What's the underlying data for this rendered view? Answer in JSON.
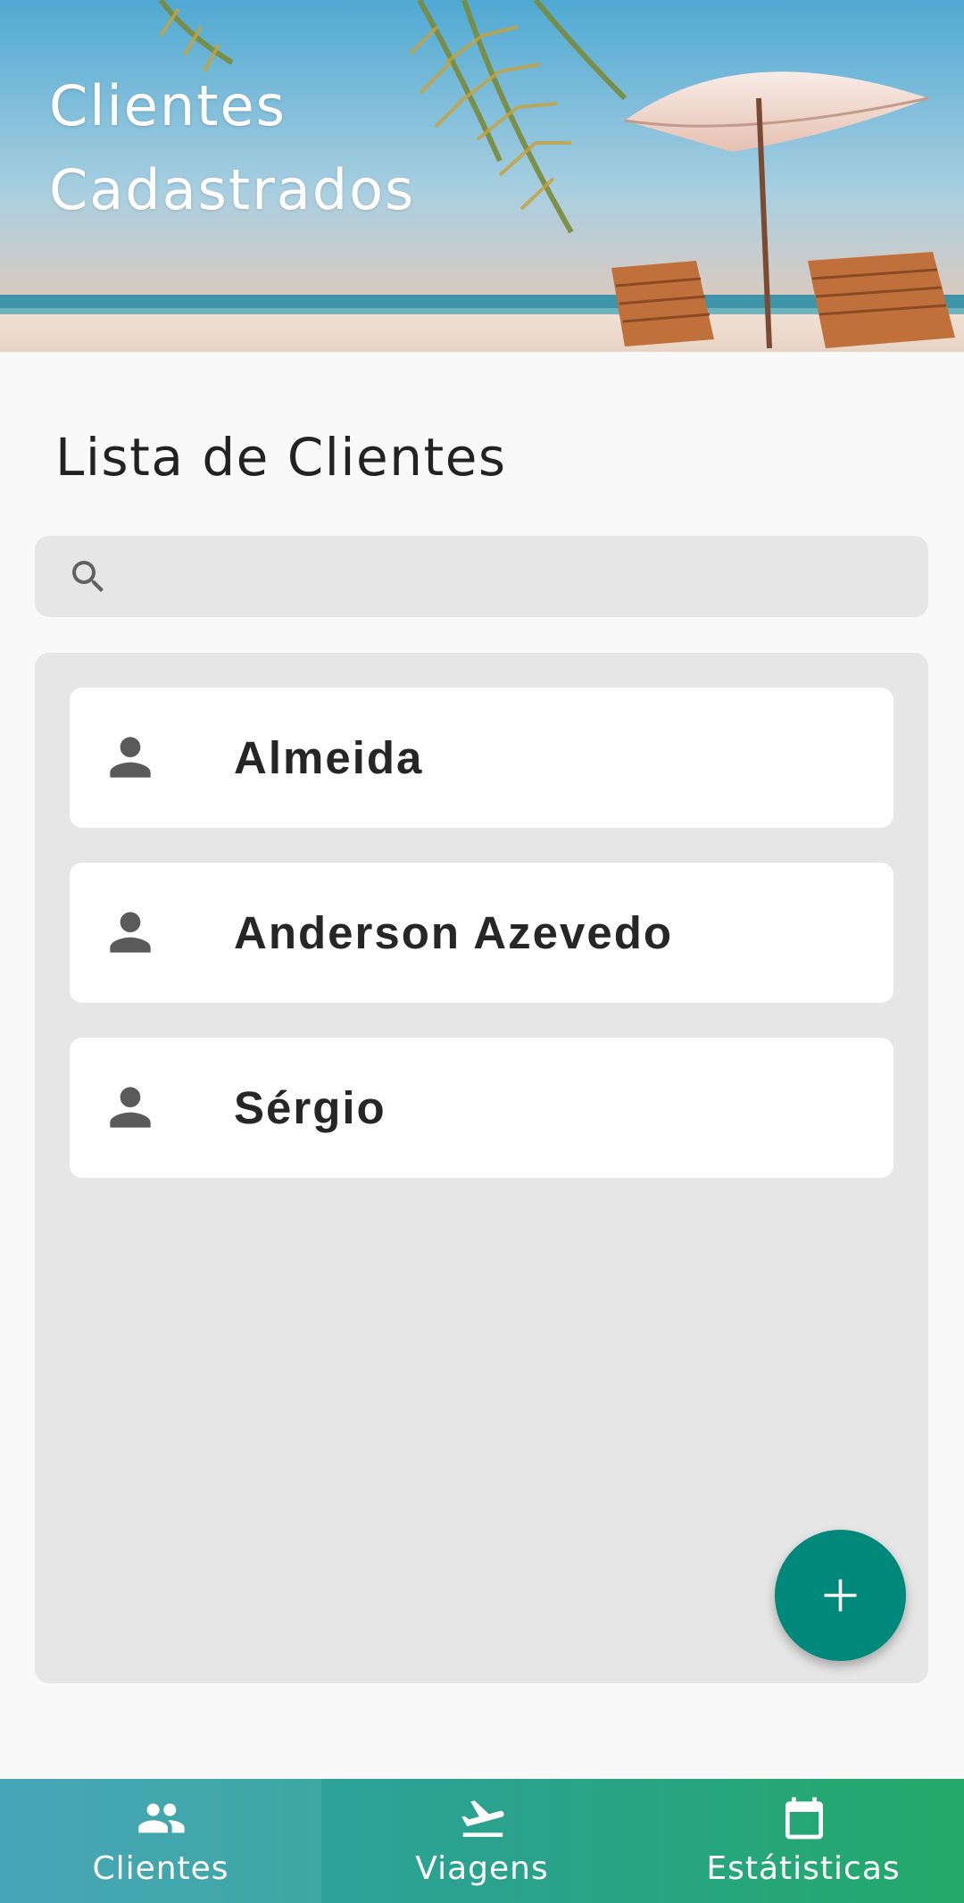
{
  "header": {
    "title_line1": "Clientes",
    "title_line2": "Cadastrados"
  },
  "section": {
    "title": "Lista de Clientes"
  },
  "search": {
    "value": "",
    "placeholder": ""
  },
  "clients": [
    {
      "name": "Almeida"
    },
    {
      "name": "Anderson Azevedo"
    },
    {
      "name": "Sérgio"
    }
  ],
  "fab": {
    "icon": "plus-icon"
  },
  "bottom_nav": {
    "active": "Clientes",
    "items": [
      {
        "label": "Clientes",
        "icon": "people-icon"
      },
      {
        "label": "Viagens",
        "icon": "airplane-icon"
      },
      {
        "label": "Estátisticas",
        "icon": "calendar-icon"
      }
    ]
  },
  "colors": {
    "accent": "#00897b",
    "nav_start": "#3aa0b4",
    "nav_end": "#23a96a",
    "panel": "#e6e6e6",
    "background": "#f9f9f9"
  }
}
